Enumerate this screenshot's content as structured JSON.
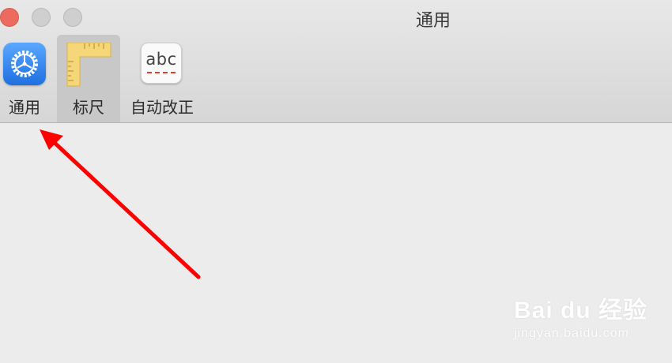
{
  "window": {
    "title": "通用"
  },
  "toolbar": {
    "tabs": [
      {
        "label": "通用",
        "icon": "gear-icon",
        "selected": false
      },
      {
        "label": "标尺",
        "icon": "ruler-icon",
        "selected": true
      },
      {
        "label": "自动改正",
        "icon": "abc-spellcheck-icon",
        "selected": false
      }
    ],
    "abc_icon_text": "abc"
  },
  "annotation": {
    "arrow_color": "#ff0000"
  },
  "watermark": {
    "main": "Bai du 经验",
    "sub": "jingyan.baidu.com"
  },
  "colors": {
    "close_button": "#ec6a5e",
    "gear_blue": "#1f6fe0",
    "ruler_yellow": "#f5d77a"
  }
}
